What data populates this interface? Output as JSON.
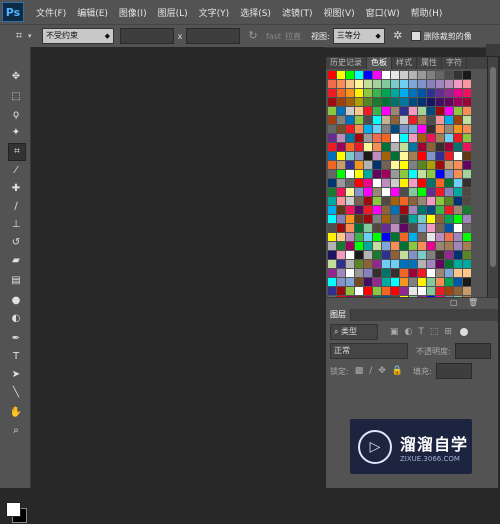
{
  "app": {
    "logo": "Ps"
  },
  "menu": [
    "文件(F)",
    "编辑(E)",
    "图像(I)",
    "图层(L)",
    "文字(Y)",
    "选择(S)",
    "滤镜(T)",
    "视图(V)",
    "窗口(W)",
    "帮助(H)"
  ],
  "options": {
    "ratio_select": "不受约束",
    "x_label": "x",
    "clear_label": "拉直",
    "clear_small": "fast",
    "view_label": "视图:",
    "view_select": "三等分",
    "delete_crop_label": "删除裁剪的像"
  },
  "panel": {
    "tabs": [
      "历史记录",
      "色板",
      "样式",
      "属性",
      "字符"
    ],
    "active_tab": "色板"
  },
  "layers": {
    "tab": "图层",
    "kind_select": "类型",
    "blend_select": "正常",
    "opacity_label": "不透明度:",
    "lock_label": "锁定:",
    "fill_label": "填充:"
  },
  "watermark": {
    "title": "溜溜自学",
    "url": "ZIXUE.3066.COM"
  },
  "colors": {
    "ui": "#535353",
    "canvas": "#282828",
    "foreground": "#ffffff",
    "background": "#000000"
  },
  "icons": [
    "move-icon",
    "marquee-icon",
    "lasso-icon",
    "magic-wand-icon",
    "crop-icon",
    "eyedropper-icon",
    "healing-brush-icon",
    "brush-icon",
    "clone-stamp-icon",
    "history-brush-icon",
    "eraser-icon",
    "gradient-icon",
    "blur-icon",
    "dodge-icon",
    "pen-icon",
    "type-icon",
    "path-selection-icon",
    "shape-icon",
    "hand-icon",
    "zoom-icon"
  ]
}
